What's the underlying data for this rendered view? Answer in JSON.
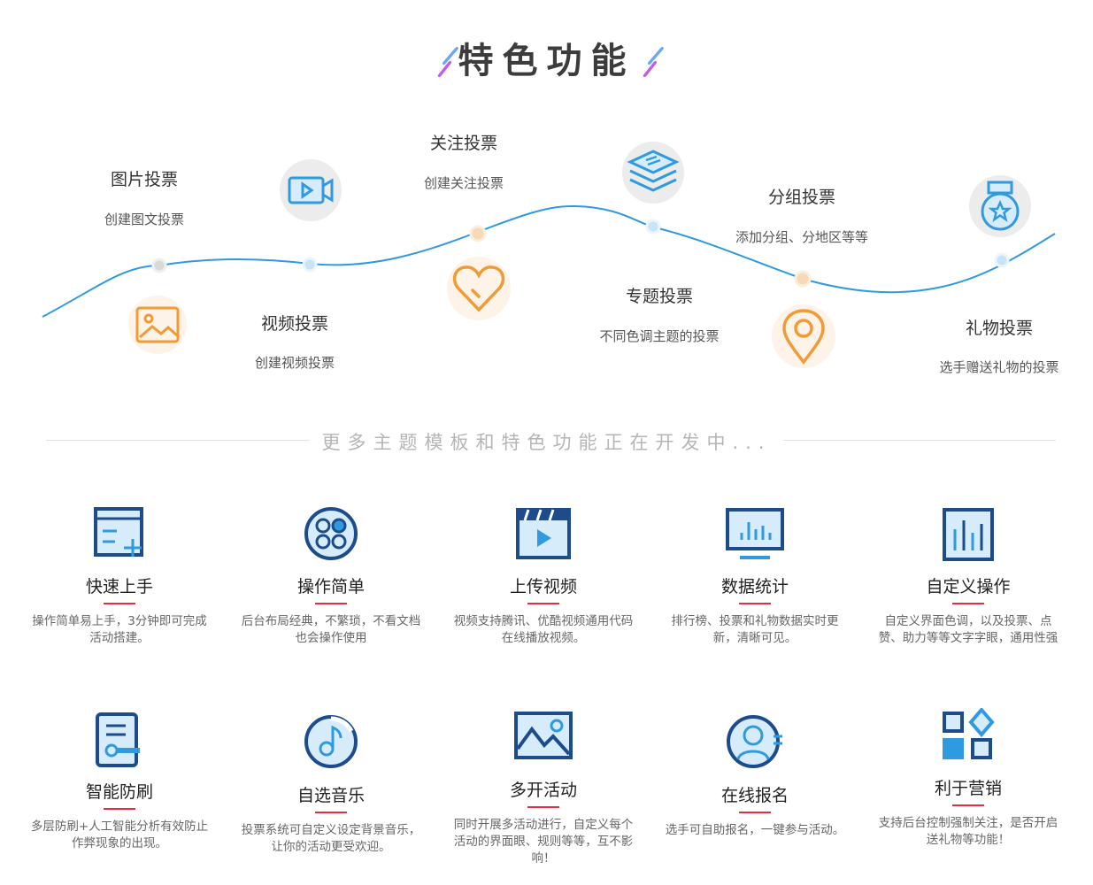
{
  "header": {
    "title": "特色功能"
  },
  "timeline": [
    {
      "id": "image",
      "title": "图片投票",
      "sub": "创建图文投票",
      "icon": "image-icon"
    },
    {
      "id": "video",
      "title": "视频投票",
      "sub": "创建视频投票",
      "icon": "video-camera-icon"
    },
    {
      "id": "follow",
      "title": "关注投票",
      "sub": "创建关注投票",
      "icon": "heart-icon"
    },
    {
      "id": "topic",
      "title": "专题投票",
      "sub": "不同色调主题的投票",
      "icon": "layers-icon"
    },
    {
      "id": "group",
      "title": "分组投票",
      "sub": "添加分组、分地区等等",
      "icon": "location-pin-icon"
    },
    {
      "id": "gift",
      "title": "礼物投票",
      "sub": "选手赠送礼物的投票",
      "icon": "medal-icon"
    }
  ],
  "more_text": "更多主题模板和特色功能正在开发中...",
  "features": [
    {
      "name": "快速上手",
      "desc": "操作简单易上手，3分钟即可完成活动搭建。",
      "icon": "quick-start-icon"
    },
    {
      "name": "操作简单",
      "desc": "后台布局经典，不繁琐，不看文档也会操作使用",
      "icon": "grid-dial-icon"
    },
    {
      "name": "上传视频",
      "desc": "视频支持腾讯、优酷视频通用代码在线播放视频。",
      "icon": "clapper-icon"
    },
    {
      "name": "数据统计",
      "desc": "排行榜、投票和礼物数据实时更新，清晰可见。",
      "icon": "monitor-chart-icon"
    },
    {
      "name": "自定义操作",
      "desc": "自定义界面色调，以及投票、点赞、助力等等文字字眼，通用性强",
      "icon": "custom-bars-icon"
    },
    {
      "name": "智能防刷",
      "desc": "多层防刷+人工智能分析有效防止作弊现象的出现。",
      "icon": "document-key-icon"
    },
    {
      "name": "自选音乐",
      "desc": "投票系统可自定义设定背景音乐，让你的活动更受欢迎。",
      "icon": "music-icon"
    },
    {
      "name": "多开活动",
      "desc": "同时开展多活动进行，自定义每个活动的界面眼、规则等等，互不影响！",
      "icon": "landscape-icon"
    },
    {
      "name": "在线报名",
      "desc": "选手可自助报名，一键参与活动。",
      "icon": "user-profile-icon"
    },
    {
      "name": "利于营销",
      "desc": "支持后台控制强制关注，是否开启送礼物等功能！",
      "icon": "apps-icon"
    }
  ],
  "colors": {
    "orange": "#f29a36",
    "blue": "#2f9ae0",
    "navy": "#1c4c8c",
    "red": "#e2313c",
    "lightblue": "#d6ecfb"
  }
}
